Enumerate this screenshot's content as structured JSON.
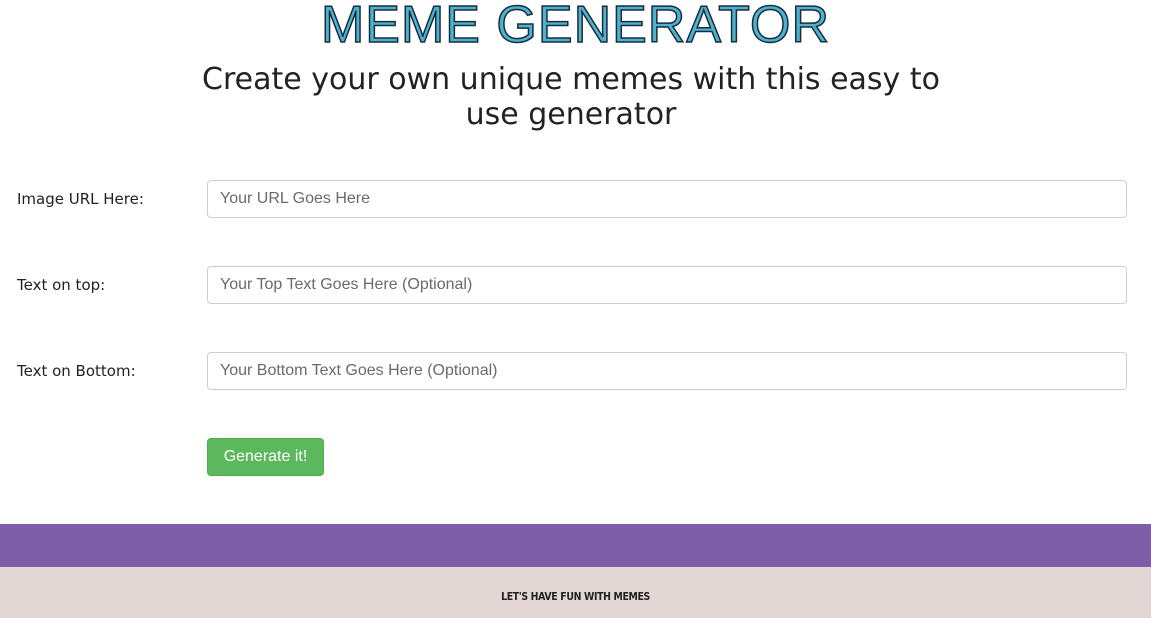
{
  "header": {
    "title": "MEME GENERATOR",
    "subtitle": "Create your own unique memes with this easy to use generator"
  },
  "form": {
    "image_url": {
      "label": "Image URL Here:",
      "placeholder": "Your URL Goes Here",
      "value": ""
    },
    "top_text": {
      "label": "Text on top:",
      "placeholder": "Your Top Text Goes Here (Optional)",
      "value": ""
    },
    "bottom_text": {
      "label": "Text on Bottom:",
      "placeholder": "Your Bottom Text Goes Here (Optional)",
      "value": ""
    },
    "submit_label": "Generate it!"
  },
  "colors": {
    "title_fill": "#4bb3cf",
    "button": "#5cb85c",
    "band": "#7e5ea9",
    "footer_bg": "#e2d7d5"
  },
  "footer": {
    "text": "LET'S HAVE FUN WITH MEMES"
  }
}
